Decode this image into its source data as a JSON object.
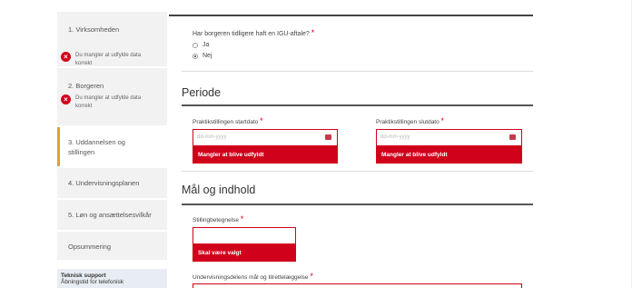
{
  "sidebar": {
    "steps": [
      {
        "label": "1. Virksomheden",
        "error": "Du mangler at udfylde data korrekt"
      },
      {
        "label": "2. Borgeren",
        "error": "Du mangler at udfylde data korrekt"
      },
      {
        "label_line1": "3. Uddannelsen og",
        "label_line2": "stillingen"
      },
      {
        "label": "4. Undervisningsplanen"
      },
      {
        "label": "5. Løn og ansættelsesvilkår"
      },
      {
        "label": "Opsummering"
      }
    ],
    "support_title": "Teknisk support",
    "support_sub": "Åbningstid for telefonisk"
  },
  "igu": {
    "question": "Har borgeren tidligere haft en IGU-aftale?",
    "required": "*",
    "options": [
      "Ja",
      "Nej"
    ],
    "selected": "Nej"
  },
  "periode": {
    "title": "Periode",
    "start_label": "Praktikstillingen startdato",
    "end_label": "Praktikstillingen slutdato",
    "placeholder": "dd-mm-yyyy",
    "error": "Mangler at blive udfyldt"
  },
  "maal": {
    "title": "Mål og indhold",
    "stilling_label": "Stillingbetegnelse",
    "stilling_error": "Skal være valgt",
    "undervisning_label": "Undervisningsdelens mål og tilrettelæggelse"
  },
  "colors": {
    "error": "#d0021b",
    "active_marker": "#e0a230"
  },
  "icons": {
    "error": "error-x-icon",
    "calendar": "calendar-icon"
  }
}
